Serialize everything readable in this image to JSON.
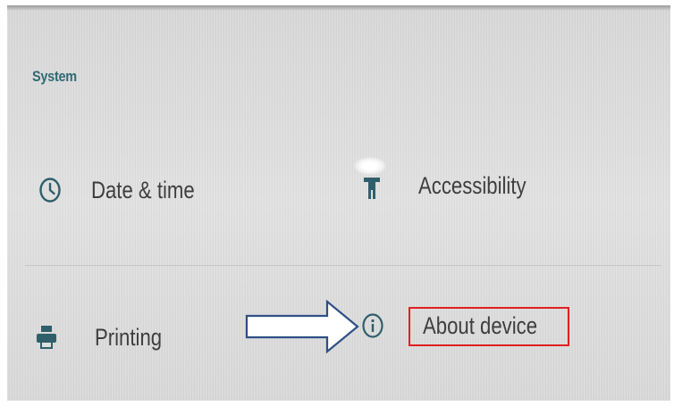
{
  "section": {
    "title": "System"
  },
  "items": [
    {
      "label": "Date & time",
      "icon": "clock-icon"
    },
    {
      "label": "Accessibility",
      "icon": "accessibility-icon"
    },
    {
      "label": "Printing",
      "icon": "printer-icon"
    },
    {
      "label": "About device",
      "icon": "info-icon"
    }
  ],
  "annotations": {
    "arrow": "white-arrow-pointing-right",
    "highlight_color": "#e02020"
  },
  "colors": {
    "section_title": "#2f6a73",
    "icon": "#2f5f6b",
    "label": "#3e3e3e",
    "background": "#dcdcdc"
  }
}
